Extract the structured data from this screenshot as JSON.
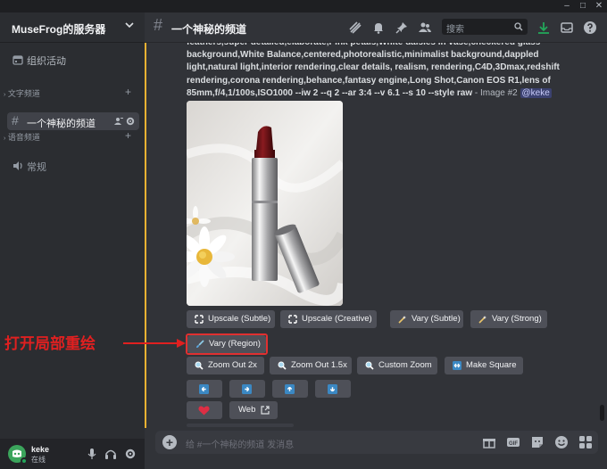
{
  "window": {
    "minimize": "–",
    "maximize": "□",
    "close": "✕"
  },
  "server": {
    "name": "MuseFrog的服务器"
  },
  "sidebar": {
    "events_label": "组织活动",
    "text_category": "文字频道",
    "active_channel": "一个神秘的频道",
    "voice_category": "语音频道",
    "voice_channel": "常规"
  },
  "user": {
    "name": "keke",
    "status": "在线"
  },
  "header": {
    "channel_name": "一个神秘的频道",
    "search_placeholder": "搜索"
  },
  "message": {
    "prompt_text": "feathers,super detailed,elaborate,Pink petals,White daisies in vase,checkered glass background,White Balance,centered,photorealistic,minimalist background,dappled light,natural light,interior rendering,clear details, realism, rendering,C4D,3Dmax,redshift rendering,corona rendering,behance,fantasy engine,Long Shot,Canon EOS R1,lens of 85mm,f/4,1/100s,ISO1000 --iw 2 --q 2 --ar 3:4 --v 6.1 --s 10 --style raw",
    "suffix": " - Image #2 ",
    "mention": "@keke"
  },
  "buttons": {
    "upscale_subtle": "Upscale (Subtle)",
    "upscale_creative": "Upscale (Creative)",
    "vary_subtle": "Vary (Subtle)",
    "vary_strong": "Vary (Strong)",
    "vary_region": "Vary (Region)",
    "zoom_out_2x": "Zoom Out 2x",
    "zoom_out_1_5x": "Zoom Out 1.5x",
    "custom_zoom": "Custom Zoom",
    "make_square": "Make Square",
    "web": "Web"
  },
  "composer": {
    "placeholder": "给 #一个神秘的频道 发消息"
  },
  "annotation": {
    "text": "打开局部重绘"
  },
  "colors": {
    "accent_bar": "#f0b232",
    "highlight_border": "#e03030",
    "annotation": "#e02020",
    "blurple_icon": "#5865f2",
    "download_green": "#23a55a"
  }
}
